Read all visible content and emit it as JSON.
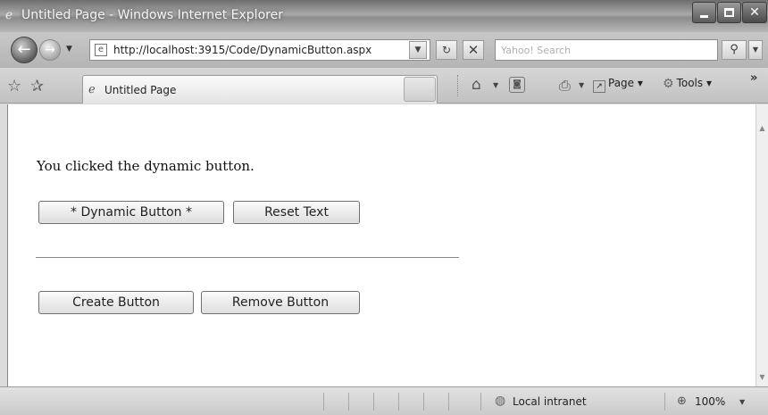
{
  "window": {
    "title": "Untitled Page - Windows Internet Explorer"
  },
  "address_bar": {
    "url": "http://localhost:3915/Code/DynamicButton.aspx"
  },
  "search": {
    "placeholder": "Yahoo! Search"
  },
  "tab": {
    "label": "Untitled Page"
  },
  "command_bar": {
    "page_label": "Page",
    "tools_label": "Tools",
    "more": "»"
  },
  "content": {
    "message": "You clicked the dynamic button.",
    "dynamic_button_label": "* Dynamic Button *",
    "reset_button_label": "Reset Text",
    "create_button_label": "Create Button",
    "remove_button_label": "Remove Button"
  },
  "status_bar": {
    "zone": "Local intranet",
    "zoom": "100%"
  },
  "icons": {
    "ie_logo": "ie-logo-icon",
    "back": "back-arrow-icon",
    "forward": "forward-arrow-icon",
    "refresh": "refresh-icon",
    "stop": "stop-icon",
    "search": "magnifier-icon",
    "favorites": "star-icon",
    "add_favorites": "add-favorites-icon",
    "home": "home-icon",
    "feeds": "feeds-icon",
    "print": "printer-icon",
    "tools": "gear-icon",
    "zone": "globe-icon",
    "zoom": "zoom-icon"
  }
}
